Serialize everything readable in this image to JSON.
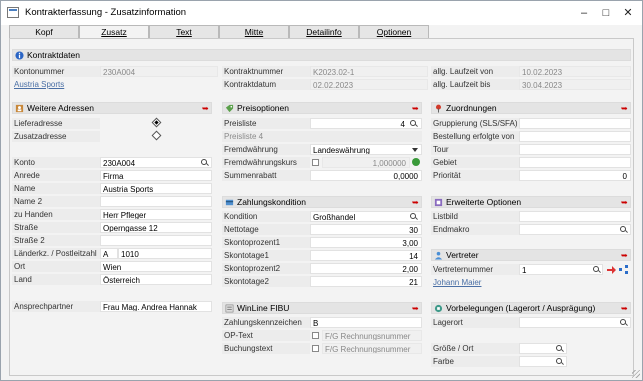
{
  "window": {
    "title": "Kontrakterfassung - Zusatzinformation"
  },
  "tabs": [
    {
      "label": "Kopf"
    },
    {
      "label": "Zusatz"
    },
    {
      "label": "Text"
    },
    {
      "label": "Mitte"
    },
    {
      "label": "Detailinfo"
    },
    {
      "label": "Optionen"
    }
  ],
  "kontraktdaten": {
    "title": "Kontraktdaten",
    "kontonummer_label": "Kontonummer",
    "kontonummer_value": "230A004",
    "kunde_link": "Austria Sports",
    "kontraktnummer_label": "Kontraktnummer",
    "kontraktnummer_value": "K2023.02-1",
    "kontraktdatum_label": "Kontraktdatum",
    "kontraktdatum_value": "02.02.2023",
    "laufzeit_von_label": "allg. Laufzeit von",
    "laufzeit_von_value": "10.02.2023",
    "laufzeit_bis_label": "allg. Laufzeit bis",
    "laufzeit_bis_value": "30.04.2023"
  },
  "adressen": {
    "title": "Weitere Adressen",
    "lieferadresse_label": "Lieferadresse",
    "zusatzadresse_label": "Zusatzadresse",
    "konto_label": "Konto",
    "konto_value": "230A004",
    "anrede_label": "Anrede",
    "anrede_value": "Firma",
    "name_label": "Name",
    "name_value": "Austria Sports",
    "name2_label": "Name 2",
    "name2_value": "",
    "zuhanden_label": "zu Handen",
    "zuhanden_value": "Herr Pfleger",
    "strasse_label": "Straße",
    "strasse_value": "Operngasse 12",
    "strasse2_label": "Straße 2",
    "strasse2_value": "",
    "laenderkz_label": "Länderkz. / Postleitzahl",
    "laenderkz_value": "A",
    "plz_value": "1010",
    "ort_label": "Ort",
    "ort_value": "Wien",
    "land_label": "Land",
    "land_value": "Österreich",
    "ansprechpartner_label": "Ansprechpartner",
    "ansprechpartner_value": "Frau Mag. Andrea Hannak"
  },
  "preisoptionen": {
    "title": "Preisoptionen",
    "preisliste_label": "Preisliste",
    "preisliste_value": "4",
    "preisliste_name": "Preisliste 4",
    "fremdwaehrung_label": "Fremdwährung",
    "fremdwaehrung_value": "Landeswährung",
    "fremdwaehrungskurs_label": "Fremdwährungskurs",
    "fremdwaehrungskurs_value": "1,000000",
    "summenrabatt_label": "Summenrabatt",
    "summenrabatt_value": "0,0000"
  },
  "zahlungskondition": {
    "title": "Zahlungskondition",
    "kondition_label": "Kondition",
    "kondition_value": "Großhandel",
    "nettotage_label": "Nettotage",
    "nettotage_value": "30",
    "skontoprozent1_label": "Skontoprozent1",
    "skontoprozent1_value": "3,00",
    "skontotage1_label": "Skontotage1",
    "skontotage1_value": "14",
    "skontoprozent2_label": "Skontoprozent2",
    "skontoprozent2_value": "2,00",
    "skontotage2_label": "Skontotage2",
    "skontotage2_value": "21"
  },
  "fibu": {
    "title": "WinLine FIBU",
    "zahlungskennzeichen_label": "Zahlungskennzeichen",
    "zahlungskennzeichen_value": "B",
    "optext_label": "OP-Text",
    "optext_value": "F/G Rechnungsnummer",
    "buchungstext_label": "Buchungstext",
    "buchungstext_value": "F/G Rechnungsnummer"
  },
  "zuordnungen": {
    "title": "Zuordnungen",
    "gruppierung_label": "Gruppierung (SLS/SFA)",
    "bestellung_label": "Bestellung erfolgte von",
    "tour_label": "Tour",
    "gebiet_label": "Gebiet",
    "prioritaet_label": "Priorität",
    "prioritaet_value": "0"
  },
  "erweiterte": {
    "title": "Erweiterte Optionen",
    "listbild_label": "Listbild",
    "endmakro_label": "Endmakro"
  },
  "vertreter": {
    "title": "Vertreter",
    "vertreternummer_label": "Vertreternummer",
    "vertreternummer_value": "1",
    "vertreter_link": "Johann Maier"
  },
  "vorbelegungen": {
    "title": "Vorbelegungen (Lagerort / Ausprägung)",
    "lagerort_label": "Lagerort",
    "groesse_label": "Größe / Ort",
    "farbe_label": "Farbe"
  },
  "colors": {
    "accent": "#4a6fa5",
    "pin": "#cc0000",
    "section_bg": "#e4e4e4"
  }
}
